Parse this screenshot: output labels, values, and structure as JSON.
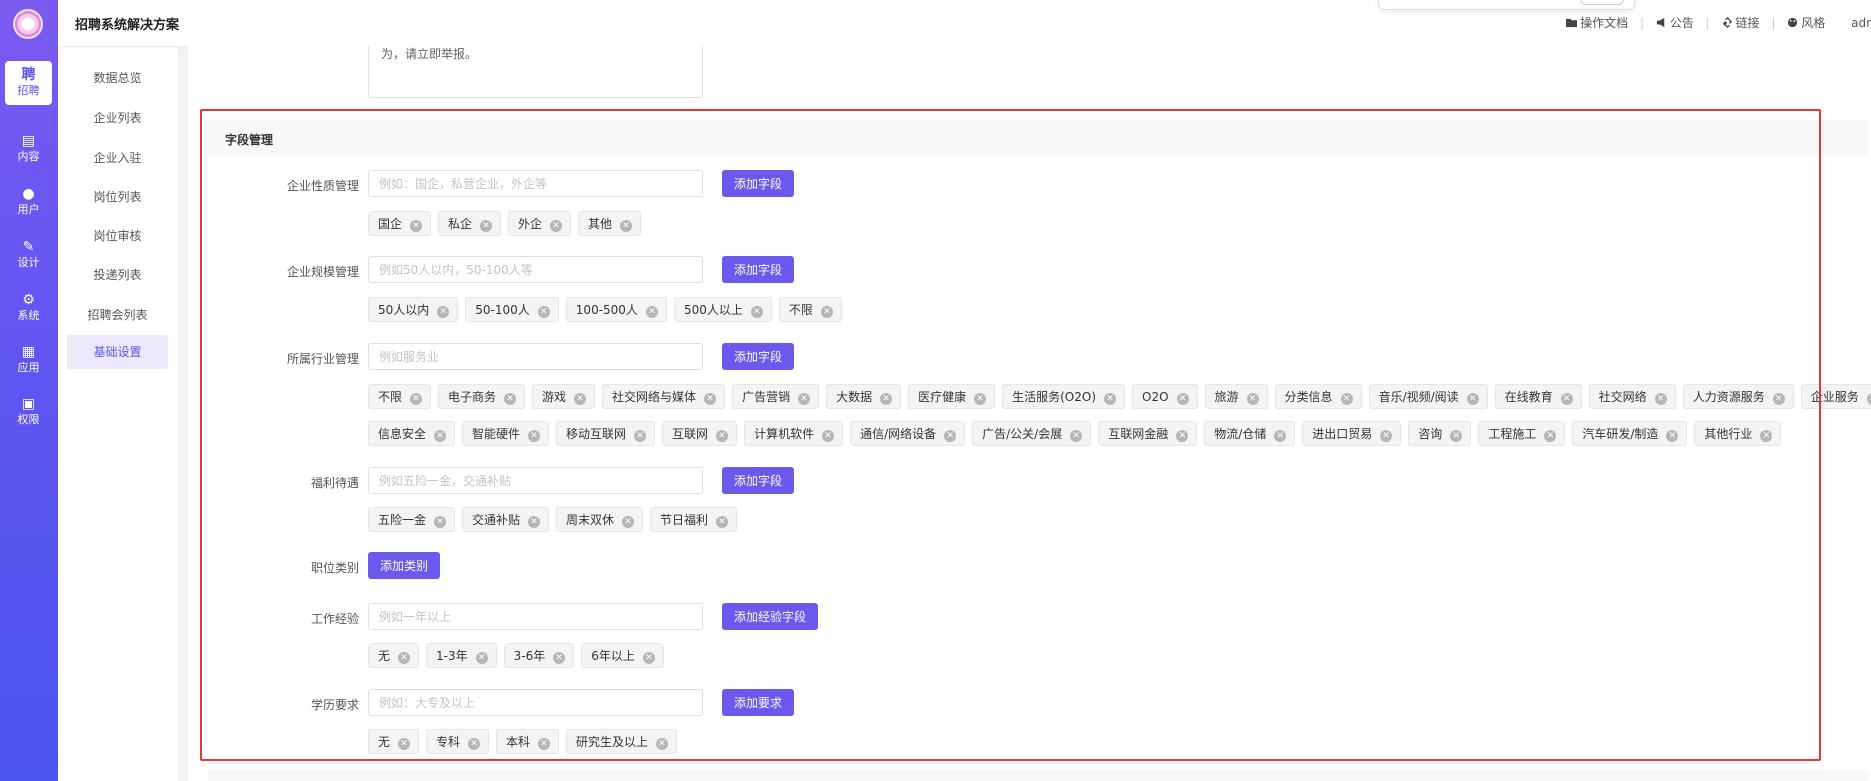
{
  "app": {
    "title": "招聘系统解决方案"
  },
  "rail": [
    {
      "glyph": "聘",
      "label": "招聘",
      "icon": "recruit-icon"
    },
    {
      "glyph": "▤",
      "label": "内容",
      "icon": "content-icon"
    },
    {
      "glyph": "●",
      "label": "用户",
      "icon": "user-icon"
    },
    {
      "glyph": "✎",
      "label": "设计",
      "icon": "design-icon"
    },
    {
      "glyph": "⚙",
      "label": "系统",
      "icon": "gear-icon"
    },
    {
      "glyph": "▦",
      "label": "应用",
      "icon": "apps-icon"
    },
    {
      "glyph": "▣",
      "label": "权限",
      "icon": "lock-icon"
    }
  ],
  "subnav": [
    "数据总览",
    "企业列表",
    "企业入驻",
    "岗位列表",
    "岗位审核",
    "投递列表",
    "招聘会列表",
    "基础设置"
  ],
  "toolbar": {
    "docs": "操作文档",
    "notice": "公告",
    "links": "链接",
    "style": "风格",
    "user": "adr"
  },
  "textarea_tail": "为，请立即举报。",
  "section_title": "字段管理",
  "rows": {
    "nature": {
      "label": "企业性质管理",
      "placeholder": "例如：国企，私营企业，外企等",
      "button": "添加字段",
      "tags": [
        "国企",
        "私企",
        "外企",
        "其他"
      ]
    },
    "scale": {
      "label": "企业规模管理",
      "placeholder": "例如50人以内，50-100人等",
      "button": "添加字段",
      "tags": [
        "50人以内",
        "50-100人",
        "100-500人",
        "500人以上",
        "不限"
      ]
    },
    "industry": {
      "label": "所属行业管理",
      "placeholder": "例如服务业",
      "button": "添加字段",
      "tags1": [
        "不限",
        "电子商务",
        "游戏",
        "社交网络与媒体",
        "广告营销",
        "大数据",
        "医疗健康",
        "生活服务(O2O)",
        "O2O",
        "旅游",
        "分类信息",
        "音乐/视频/阅读",
        "在线教育",
        "社交网络",
        "人力资源服务",
        "企业服务"
      ],
      "tags2": [
        "信息安全",
        "智能硬件",
        "移动互联网",
        "互联网",
        "计算机软件",
        "通信/网络设备",
        "广告/公关/会展",
        "互联网金融",
        "物流/仓储",
        "进出口贸易",
        "咨询",
        "工程施工",
        "汽车研发/制造",
        "其他行业"
      ]
    },
    "welfare": {
      "label": "福利待遇",
      "placeholder": "例如五险一金，交通补贴",
      "button": "添加字段",
      "tags": [
        "五险一金",
        "交通补贴",
        "周末双休",
        "节日福利"
      ]
    },
    "category": {
      "label": "职位类别",
      "button": "添加类别"
    },
    "experience": {
      "label": "工作经验",
      "placeholder": "例如一年以上",
      "button": "添加经验字段",
      "tags": [
        "无",
        "1-3年",
        "3-6年",
        "6年以上"
      ]
    },
    "education": {
      "label": "学历要求",
      "placeholder": "例如：大专及以上",
      "button": "添加要求",
      "tags": [
        "无",
        "专科",
        "本科",
        "研究生及以上"
      ]
    }
  },
  "colors": {
    "accent": "#6b59ee",
    "highlight": "#e8372c",
    "rail": "#6155f2"
  }
}
